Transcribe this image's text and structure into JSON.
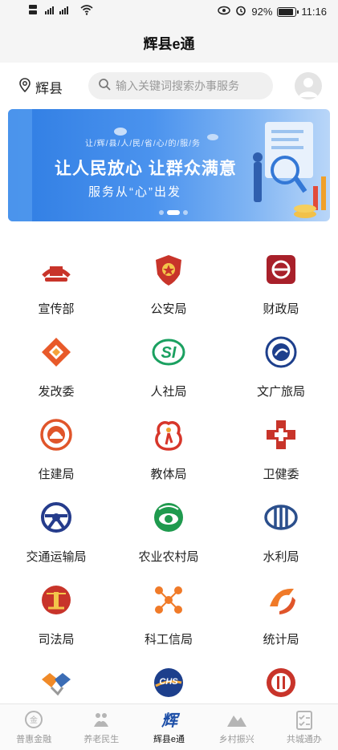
{
  "status_bar": {
    "network_left": "HD 5G",
    "network_right": "HD 4G",
    "battery_percent_text": "92%",
    "battery_level": 0.92,
    "time": "11:16",
    "icons": [
      "eye-icon",
      "alarm-icon",
      "battery-icon",
      "wifi-icon",
      "signal-icon"
    ]
  },
  "header": {
    "title": "辉县e通"
  },
  "search_row": {
    "location": "辉县",
    "search_placeholder": "输入关键词搜索办事服务"
  },
  "banner": {
    "subtitle": "让/辉/县/人/民/省/心/的/服/务",
    "headline": "让人民放心 让群众满意",
    "tagline": "服务从“心”出发",
    "active_slide": 2,
    "slide_count": 3
  },
  "grid": [
    {
      "label": "宣传部",
      "icon": "propaganda-icon",
      "color": "#c8342a"
    },
    {
      "label": "公安局",
      "icon": "police-badge-icon",
      "color": "#c8342a"
    },
    {
      "label": "财政局",
      "icon": "finance-icon",
      "color": "#a8202a"
    },
    {
      "label": "发改委",
      "icon": "development-icon",
      "color": "#e85a2a"
    },
    {
      "label": "人社局",
      "icon": "social-security-icon",
      "color": "#1aa060"
    },
    {
      "label": "文广旅局",
      "icon": "culture-tourism-icon",
      "color": "#1d3f8c"
    },
    {
      "label": "住建局",
      "icon": "housing-icon",
      "color": "#e0552a"
    },
    {
      "label": "教体局",
      "icon": "education-icon",
      "color": "#d7362a"
    },
    {
      "label": "卫健委",
      "icon": "health-cross-icon",
      "color": "#c8342a"
    },
    {
      "label": "交通运输局",
      "icon": "transport-icon",
      "color": "#253c8c"
    },
    {
      "label": "农业农村局",
      "icon": "agriculture-icon",
      "color": "#1f9a4e"
    },
    {
      "label": "水利局",
      "icon": "water-icon",
      "color": "#2b4f8c"
    },
    {
      "label": "司法局",
      "icon": "justice-emblem-icon",
      "color": "#c8342a"
    },
    {
      "label": "科工信局",
      "icon": "science-icon",
      "color": "#f07a28"
    },
    {
      "label": "统计局",
      "icon": "statistics-icon",
      "color": "#f07a28"
    },
    {
      "label": "",
      "icon": "handshake-icon",
      "color": "#f08a28"
    },
    {
      "label": "",
      "icon": "chs-icon",
      "color": "#1d3f8c"
    },
    {
      "label": "",
      "icon": "emblem-icon",
      "color": "#c8342a"
    }
  ],
  "bottom_nav": [
    {
      "label": "普惠金融",
      "icon": "finance-coin-icon",
      "active": false
    },
    {
      "label": "养老民生",
      "icon": "elderly-icon",
      "active": false
    },
    {
      "label": "辉县e通",
      "icon": "app-logo-icon",
      "active": true
    },
    {
      "label": "乡村振兴",
      "icon": "mountain-icon",
      "active": false
    },
    {
      "label": "共城通办",
      "icon": "checklist-icon",
      "active": false
    }
  ]
}
